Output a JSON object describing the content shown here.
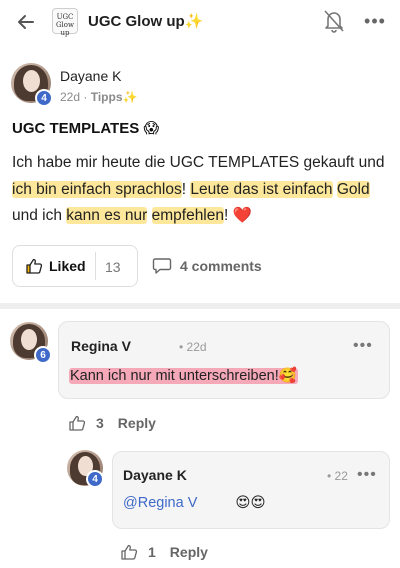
{
  "header": {
    "group_logo_text": "UGC Glow up",
    "group_title": "UGC Glow up✨",
    "more_glyph": "•••"
  },
  "post": {
    "author": "Dayane K",
    "author_level": "4",
    "age": "22d",
    "dot": "·",
    "tag": "Tipps✨",
    "title": "UGC TEMPLATES 😱",
    "body_parts": [
      "Ich habe mir heute die UGC TEMPLATES gekauft und ",
      "ich bin einfach sprachlos",
      "! ",
      "Leute das ist einfach",
      " ",
      "Gold",
      " und ich ",
      "kann es nur",
      " ",
      "empfehlen",
      "! ❤️"
    ],
    "like_label": "Liked",
    "like_count": "13",
    "comments_label": "4 comments"
  },
  "comments": [
    {
      "author": "Regina V",
      "author_level": "6",
      "meta": "• 22d",
      "text": "Kann ich nur mit unterschreiben!🥰",
      "like_count": "3",
      "reply_label": "Reply"
    },
    {
      "author": "Dayane K",
      "author_level": "4",
      "meta": "• 22",
      "mention": "@Regina V",
      "emoji": "😍😍",
      "like_count": "1",
      "reply_label": "Reply"
    }
  ],
  "colors": {
    "accent": "#3f6ac9",
    "highlight_yellow": "#fde79a",
    "highlight_pink": "#f4a8b8",
    "heart": "#d81b3c"
  },
  "icons": [
    "back-arrow-icon",
    "bell-off-icon",
    "more-icon",
    "thumbs-up-icon",
    "comment-icon"
  ]
}
